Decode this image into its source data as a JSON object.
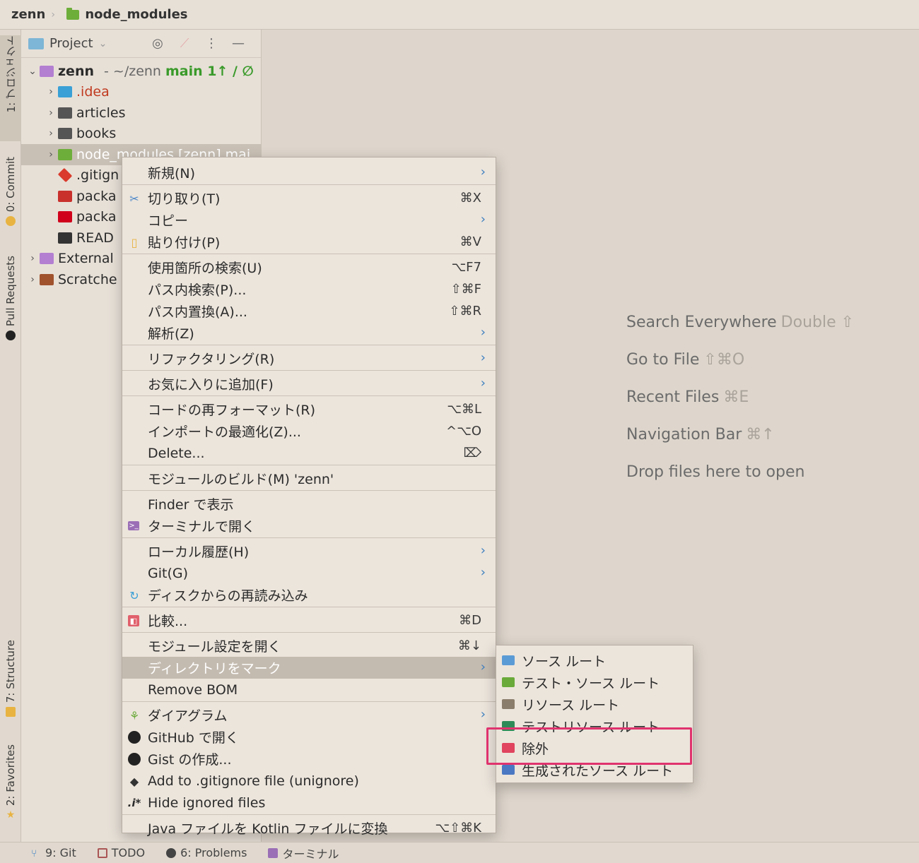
{
  "breadcrumb": {
    "root": "zenn",
    "current": "node_modules"
  },
  "stripe": {
    "project_tab": "1: プロジェクト",
    "commit_tab": "0: Commit",
    "pull_requests_tab": "Pull Requests",
    "structure_tab": "7: Structure",
    "favorites_tab": "2: Favorites"
  },
  "panel": {
    "title": "Project",
    "tree": [
      {
        "label": "zenn",
        "suffix": "- ~/zenn",
        "branch": "main 1↑ / ∅"
      },
      {
        "label": ".idea"
      },
      {
        "label": "articles"
      },
      {
        "label": "books"
      },
      {
        "label": "node_modules [zenn] mai"
      },
      {
        "label": ".gitign"
      },
      {
        "label": "packa"
      },
      {
        "label": "packa"
      },
      {
        "label": "READ"
      },
      {
        "label": "External"
      },
      {
        "label": "Scratche"
      }
    ]
  },
  "hints": [
    {
      "label": "Search Everywhere",
      "shortcut": "Double ⇧"
    },
    {
      "label": "Go to File",
      "shortcut": "⇧⌘O"
    },
    {
      "label": "Recent Files",
      "shortcut": "⌘E"
    },
    {
      "label": "Navigation Bar",
      "shortcut": "⌘↑"
    },
    {
      "label": "Drop files here to open",
      "shortcut": ""
    }
  ],
  "menu": [
    {
      "label": "新規(N)",
      "shortcut": "",
      "submenu": true
    },
    {
      "label": "切り取り(T)",
      "shortcut": "⌘X"
    },
    {
      "label": "コピー",
      "shortcut": "",
      "submenu": true
    },
    {
      "label": "貼り付け(P)",
      "shortcut": "⌘V"
    },
    {
      "label": "使用箇所の検索(U)",
      "shortcut": "⌥F7"
    },
    {
      "label": "パス内検索(P)...",
      "shortcut": "⇧⌘F"
    },
    {
      "label": "パス内置換(A)...",
      "shortcut": "⇧⌘R"
    },
    {
      "label": "解析(Z)",
      "shortcut": "",
      "submenu": true
    },
    {
      "label": "リファクタリング(R)",
      "shortcut": "",
      "submenu": true
    },
    {
      "label": "お気に入りに追加(F)",
      "shortcut": "",
      "submenu": true
    },
    {
      "label": "コードの再フォーマット(R)",
      "shortcut": "⌥⌘L"
    },
    {
      "label": "インポートの最適化(Z)...",
      "shortcut": "^⌥O"
    },
    {
      "label": "Delete...",
      "shortcut": "⌦"
    },
    {
      "label": "モジュールのビルド(M) 'zenn'",
      "shortcut": ""
    },
    {
      "label": "Finder で表示",
      "shortcut": ""
    },
    {
      "label": "ターミナルで開く",
      "shortcut": ""
    },
    {
      "label": "ローカル履歴(H)",
      "shortcut": "",
      "submenu": true
    },
    {
      "label": "Git(G)",
      "shortcut": "",
      "submenu": true
    },
    {
      "label": "ディスクからの再読み込み",
      "shortcut": ""
    },
    {
      "label": "比較...",
      "shortcut": "⌘D"
    },
    {
      "label": "モジュール設定を開く",
      "shortcut": "⌘↓"
    },
    {
      "label": "ディレクトリをマーク",
      "shortcut": "",
      "submenu": true
    },
    {
      "label": "Remove BOM",
      "shortcut": ""
    },
    {
      "label": "ダイアグラム",
      "shortcut": "",
      "submenu": true
    },
    {
      "label": "GitHub で開く",
      "shortcut": ""
    },
    {
      "label": "Gist の作成...",
      "shortcut": ""
    },
    {
      "label": "Add to .gitignore file (unignore)",
      "shortcut": ""
    },
    {
      "label": "Hide ignored files",
      "shortcut": ""
    },
    {
      "label": "Java ファイルを Kotlin ファイルに変換",
      "shortcut": "⌥⇧⌘K"
    }
  ],
  "submenu": [
    {
      "label": "ソース ルート",
      "color": "#5b9bd5"
    },
    {
      "label": "テスト・ソース ルート",
      "color": "#6aaa3a"
    },
    {
      "label": "リソース ルート",
      "color": "#8b7d6b"
    },
    {
      "label": "テストリソース ルート",
      "color": "#2e8b57"
    },
    {
      "label": "除外",
      "color": "#e0445e"
    },
    {
      "label": "生成されたソース ルート",
      "color": "#4a78c2"
    }
  ],
  "statusbar": {
    "git": "9: Git",
    "todo": "TODO",
    "problems": "6: Problems",
    "terminal": "ターミナル"
  },
  "icons": {
    "submenu_arrow": "chevron-right-icon",
    "scissors": "scissors-icon"
  }
}
